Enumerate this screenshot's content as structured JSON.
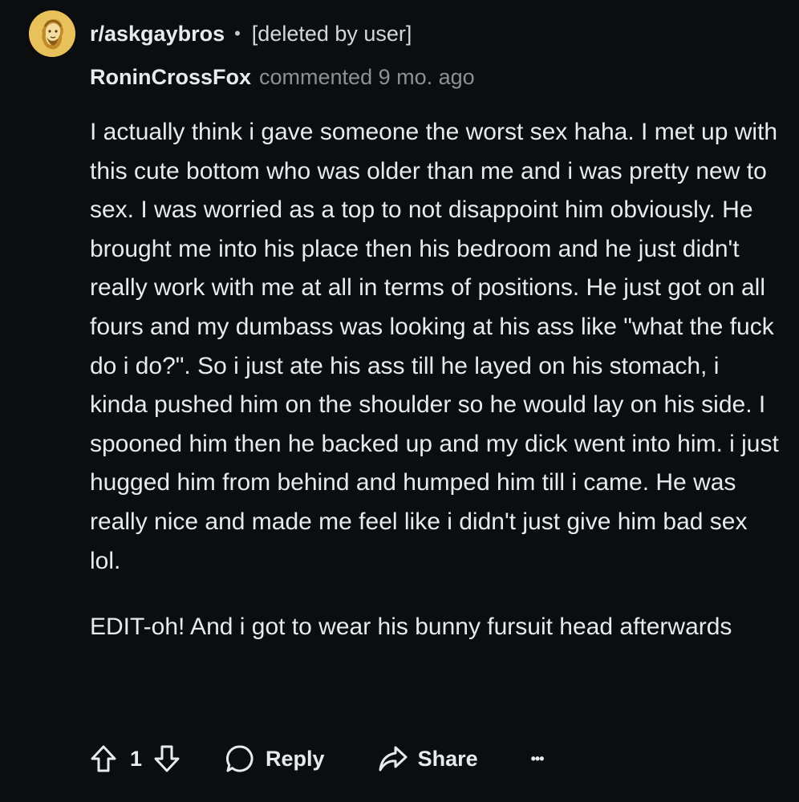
{
  "header": {
    "subreddit": "r/askgaybros",
    "separator": "•",
    "status": "[deleted by user]"
  },
  "comment": {
    "author": "RoninCrossFox",
    "meta": "commented 9 mo. ago",
    "paragraphs": [
      "I actually think i gave someone the worst sex haha. I met up with this cute bottom who was older than me and i was pretty new to sex. I was worried as a top to not disappoint him obviously. He brought me into his place then his bedroom and he just didn't really work with me at all in terms of positions. He just got on all fours and my dumbass was looking at his ass like \"what the fuck do i do?\". So i just ate his ass till he layed on his stomach, i kinda pushed him on the shoulder so he would lay on his side. I spooned him then he backed up and my dick went into him. i just hugged him from behind and humped him till i came. He was really nice and made me feel like i didn't just give him bad sex lol.",
      "EDIT-oh! And i got to wear his bunny fursuit head afterwards"
    ]
  },
  "actions": {
    "vote_count": "1",
    "reply_label": "Reply",
    "share_label": "Share",
    "more_label": "•••",
    "upvote_icon": "upvote-arrow-icon",
    "downvote_icon": "downvote-arrow-icon",
    "reply_icon": "speech-bubble-icon",
    "share_icon": "share-arrow-icon"
  },
  "colors": {
    "background": "#0b0d0f",
    "text": "#e7eaee",
    "muted": "#8b9197",
    "avatar": "#e9c15a"
  }
}
